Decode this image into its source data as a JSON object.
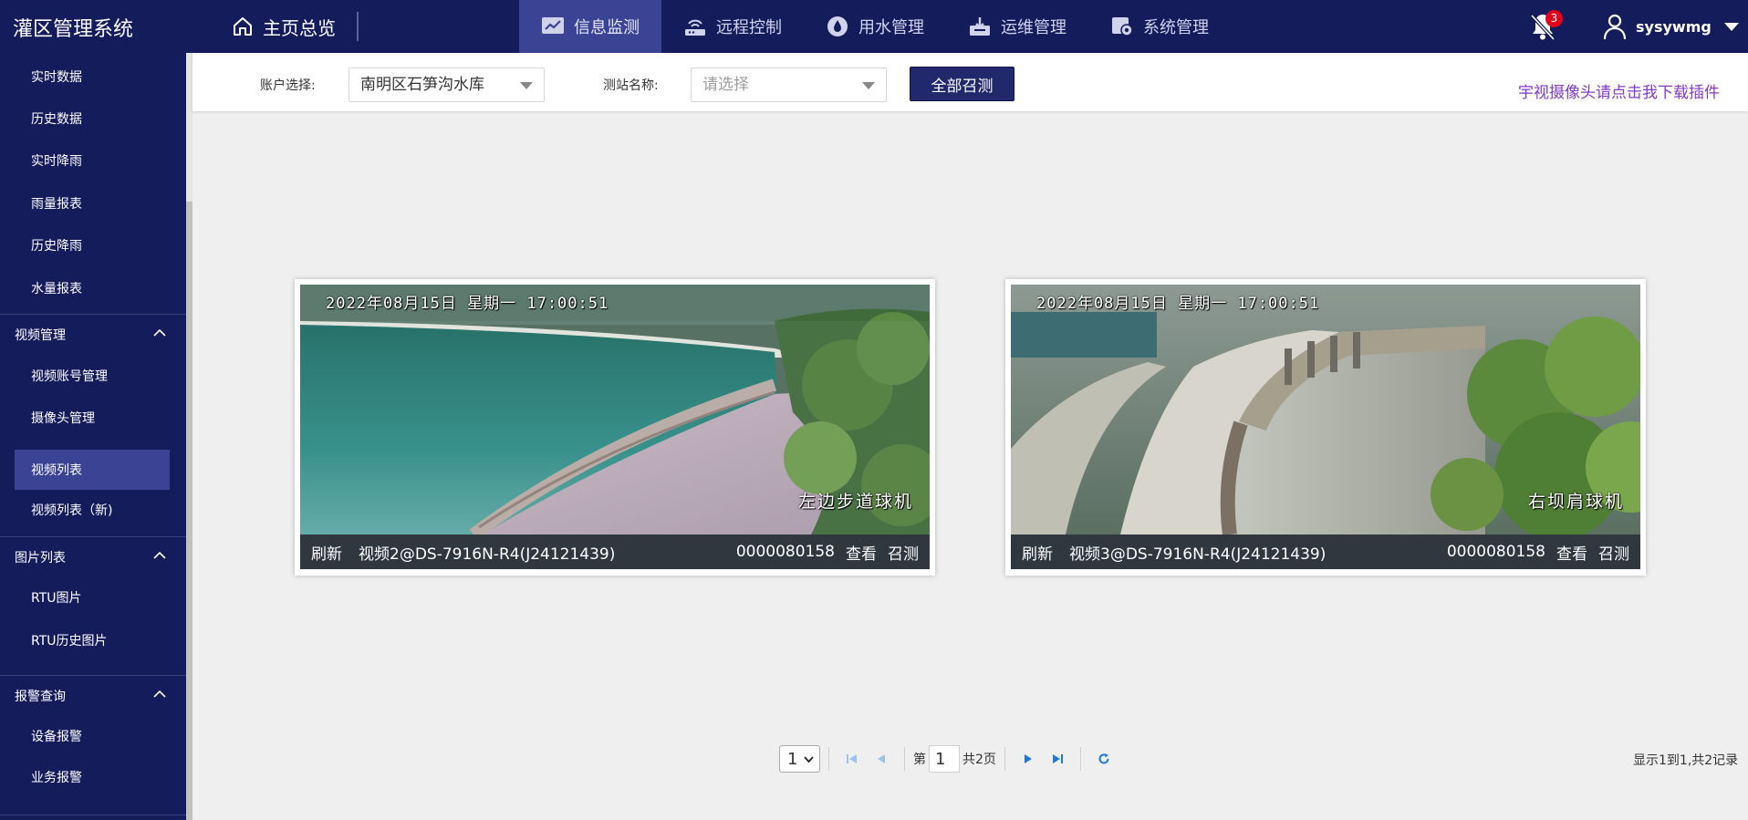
{
  "app": {
    "title": "灌区管理系统"
  },
  "header": {
    "home_label": "主页总览",
    "nav": [
      {
        "label": "信息监测",
        "icon": "chart-icon",
        "active": true
      },
      {
        "label": "远程控制",
        "icon": "router-icon",
        "active": false
      },
      {
        "label": "用水管理",
        "icon": "water-drop-icon",
        "active": false
      },
      {
        "label": "运维管理",
        "icon": "maintenance-icon",
        "active": false
      },
      {
        "label": "系统管理",
        "icon": "settings-icon",
        "active": false
      }
    ],
    "notification_count": "3",
    "username": "sysywmg"
  },
  "sidebar": {
    "items": [
      {
        "label": "实时数据"
      },
      {
        "label": "历史数据"
      },
      {
        "label": "实时降雨"
      },
      {
        "label": "雨量报表"
      },
      {
        "label": "历史降雨"
      },
      {
        "label": "水量报表"
      }
    ],
    "groups": [
      {
        "label": "视频管理",
        "expanded": true,
        "items": [
          {
            "label": "视频账号管理",
            "active": false
          },
          {
            "label": "摄像头管理",
            "active": false
          },
          {
            "label": "视频列表",
            "active": true
          },
          {
            "label": "视频列表（新)",
            "active": false
          }
        ]
      },
      {
        "label": "图片列表",
        "expanded": true,
        "items": [
          {
            "label": "RTU图片",
            "active": false
          },
          {
            "label": "RTU历史图片",
            "active": false
          }
        ]
      },
      {
        "label": "报警查询",
        "expanded": true,
        "items": [
          {
            "label": "设备报警",
            "active": false
          },
          {
            "label": "业务报警",
            "active": false
          }
        ]
      }
    ]
  },
  "filters": {
    "account_label": "账户选择:",
    "account_value": "南明区石笋沟水库",
    "station_label": "测站名称:",
    "station_placeholder": "请选择",
    "call_all_label": "全部召测",
    "plugin_link": "宇视摄像头请点击我下载插件"
  },
  "videos": [
    {
      "osd_time": "2022年08月15日  星期一  17:00:51",
      "osd_camera": "左边步道球机",
      "refresh": "刷新",
      "name": "视频2@DS-7916N-R4(J24121439)",
      "code": "0000080158",
      "view": "查看",
      "call": "召测"
    },
    {
      "osd_time": "2022年08月15日  星期一  17:00:51",
      "osd_camera": "右坝肩球机",
      "refresh": "刷新",
      "name": "视频3@DS-7916N-R4(J24121439)",
      "code": "0000080158",
      "view": "查看",
      "call": "召测"
    }
  ],
  "pagination": {
    "page_size": "1",
    "page_prefix": "第",
    "current_page": "1",
    "total_pages": "共2页",
    "summary": "显示1到1,共2记录"
  },
  "colors": {
    "header_bg": "#151c5c",
    "active_nav": "#3a4394",
    "primary_button": "#21296c",
    "link": "#8439c9",
    "badge": "#e2001a"
  }
}
